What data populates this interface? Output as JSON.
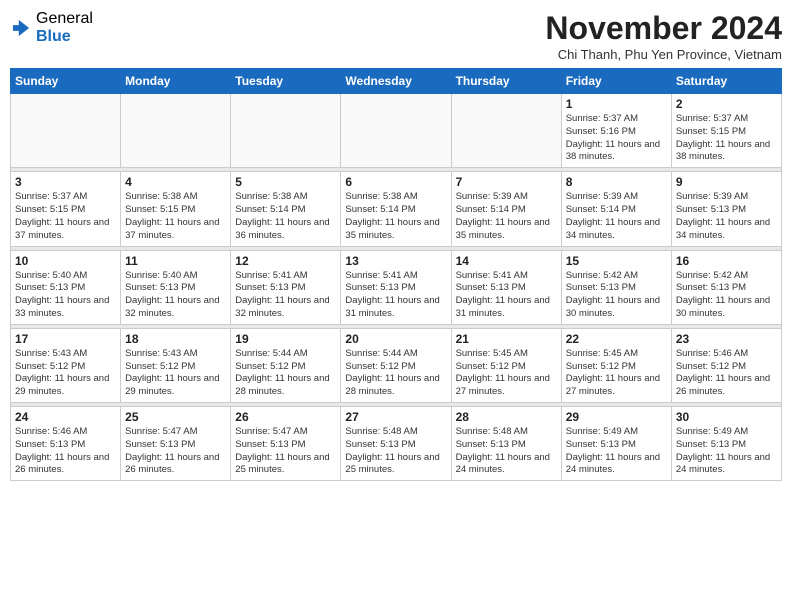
{
  "header": {
    "logo": {
      "general": "General",
      "blue": "Blue"
    },
    "month_title": "November 2024",
    "location": "Chi Thanh, Phu Yen Province, Vietnam"
  },
  "weekdays": [
    "Sunday",
    "Monday",
    "Tuesday",
    "Wednesday",
    "Thursday",
    "Friday",
    "Saturday"
  ],
  "weeks": [
    {
      "days": [
        {
          "num": "",
          "info": ""
        },
        {
          "num": "",
          "info": ""
        },
        {
          "num": "",
          "info": ""
        },
        {
          "num": "",
          "info": ""
        },
        {
          "num": "",
          "info": ""
        },
        {
          "num": "1",
          "info": "Sunrise: 5:37 AM\nSunset: 5:16 PM\nDaylight: 11 hours and 38 minutes."
        },
        {
          "num": "2",
          "info": "Sunrise: 5:37 AM\nSunset: 5:15 PM\nDaylight: 11 hours and 38 minutes."
        }
      ]
    },
    {
      "days": [
        {
          "num": "3",
          "info": "Sunrise: 5:37 AM\nSunset: 5:15 PM\nDaylight: 11 hours and 37 minutes."
        },
        {
          "num": "4",
          "info": "Sunrise: 5:38 AM\nSunset: 5:15 PM\nDaylight: 11 hours and 37 minutes."
        },
        {
          "num": "5",
          "info": "Sunrise: 5:38 AM\nSunset: 5:14 PM\nDaylight: 11 hours and 36 minutes."
        },
        {
          "num": "6",
          "info": "Sunrise: 5:38 AM\nSunset: 5:14 PM\nDaylight: 11 hours and 35 minutes."
        },
        {
          "num": "7",
          "info": "Sunrise: 5:39 AM\nSunset: 5:14 PM\nDaylight: 11 hours and 35 minutes."
        },
        {
          "num": "8",
          "info": "Sunrise: 5:39 AM\nSunset: 5:14 PM\nDaylight: 11 hours and 34 minutes."
        },
        {
          "num": "9",
          "info": "Sunrise: 5:39 AM\nSunset: 5:13 PM\nDaylight: 11 hours and 34 minutes."
        }
      ]
    },
    {
      "days": [
        {
          "num": "10",
          "info": "Sunrise: 5:40 AM\nSunset: 5:13 PM\nDaylight: 11 hours and 33 minutes."
        },
        {
          "num": "11",
          "info": "Sunrise: 5:40 AM\nSunset: 5:13 PM\nDaylight: 11 hours and 32 minutes."
        },
        {
          "num": "12",
          "info": "Sunrise: 5:41 AM\nSunset: 5:13 PM\nDaylight: 11 hours and 32 minutes."
        },
        {
          "num": "13",
          "info": "Sunrise: 5:41 AM\nSunset: 5:13 PM\nDaylight: 11 hours and 31 minutes."
        },
        {
          "num": "14",
          "info": "Sunrise: 5:41 AM\nSunset: 5:13 PM\nDaylight: 11 hours and 31 minutes."
        },
        {
          "num": "15",
          "info": "Sunrise: 5:42 AM\nSunset: 5:13 PM\nDaylight: 11 hours and 30 minutes."
        },
        {
          "num": "16",
          "info": "Sunrise: 5:42 AM\nSunset: 5:13 PM\nDaylight: 11 hours and 30 minutes."
        }
      ]
    },
    {
      "days": [
        {
          "num": "17",
          "info": "Sunrise: 5:43 AM\nSunset: 5:12 PM\nDaylight: 11 hours and 29 minutes."
        },
        {
          "num": "18",
          "info": "Sunrise: 5:43 AM\nSunset: 5:12 PM\nDaylight: 11 hours and 29 minutes."
        },
        {
          "num": "19",
          "info": "Sunrise: 5:44 AM\nSunset: 5:12 PM\nDaylight: 11 hours and 28 minutes."
        },
        {
          "num": "20",
          "info": "Sunrise: 5:44 AM\nSunset: 5:12 PM\nDaylight: 11 hours and 28 minutes."
        },
        {
          "num": "21",
          "info": "Sunrise: 5:45 AM\nSunset: 5:12 PM\nDaylight: 11 hours and 27 minutes."
        },
        {
          "num": "22",
          "info": "Sunrise: 5:45 AM\nSunset: 5:12 PM\nDaylight: 11 hours and 27 minutes."
        },
        {
          "num": "23",
          "info": "Sunrise: 5:46 AM\nSunset: 5:12 PM\nDaylight: 11 hours and 26 minutes."
        }
      ]
    },
    {
      "days": [
        {
          "num": "24",
          "info": "Sunrise: 5:46 AM\nSunset: 5:13 PM\nDaylight: 11 hours and 26 minutes."
        },
        {
          "num": "25",
          "info": "Sunrise: 5:47 AM\nSunset: 5:13 PM\nDaylight: 11 hours and 26 minutes."
        },
        {
          "num": "26",
          "info": "Sunrise: 5:47 AM\nSunset: 5:13 PM\nDaylight: 11 hours and 25 minutes."
        },
        {
          "num": "27",
          "info": "Sunrise: 5:48 AM\nSunset: 5:13 PM\nDaylight: 11 hours and 25 minutes."
        },
        {
          "num": "28",
          "info": "Sunrise: 5:48 AM\nSunset: 5:13 PM\nDaylight: 11 hours and 24 minutes."
        },
        {
          "num": "29",
          "info": "Sunrise: 5:49 AM\nSunset: 5:13 PM\nDaylight: 11 hours and 24 minutes."
        },
        {
          "num": "30",
          "info": "Sunrise: 5:49 AM\nSunset: 5:13 PM\nDaylight: 11 hours and 24 minutes."
        }
      ]
    }
  ]
}
